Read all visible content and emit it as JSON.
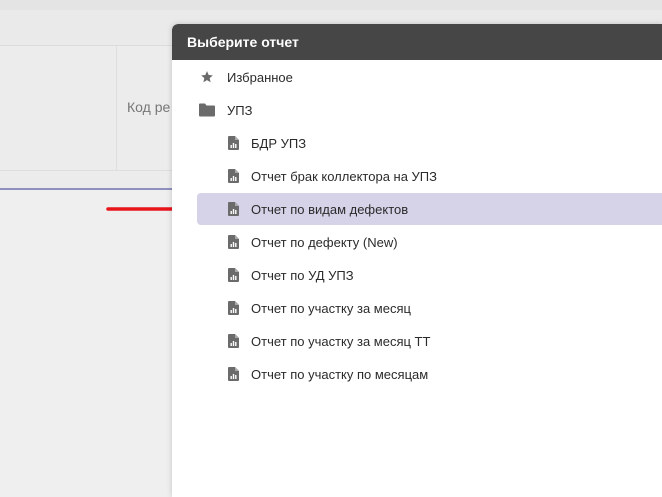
{
  "background": {
    "column_header": "Код ре"
  },
  "panel": {
    "title": "Выберите отчет",
    "favorites_label": "Избранное",
    "folder_label": "УПЗ",
    "reports": [
      "БДР УПЗ",
      "Отчет брак коллектора на УПЗ",
      "Отчет по видам дефектов",
      "Отчет по дефекту (New)",
      "Отчет по УД УПЗ",
      "Отчет по участку за месяц",
      "Отчет по участку за месяц ТТ",
      "Отчет по участку по месяцам"
    ],
    "selected_index": 2
  },
  "icons": {
    "favorites": "star-icon",
    "folder": "folder-icon",
    "report": "report-file-icon",
    "annotation": "red-arrow-icon"
  },
  "colors": {
    "header_bg": "#464646",
    "selected_bg": "#d6d2e8",
    "arrow": "#e8151b",
    "icon": "#6b6b6b"
  }
}
